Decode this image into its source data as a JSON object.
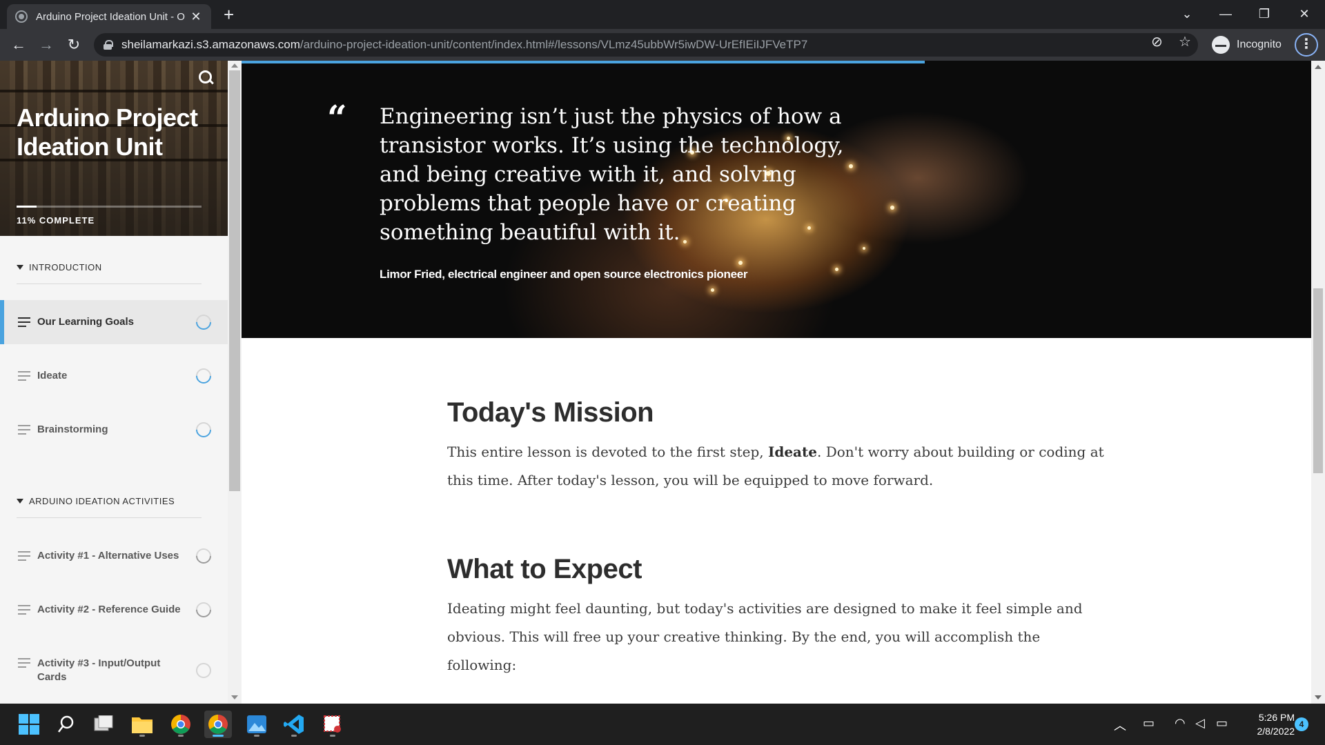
{
  "browser": {
    "tab_title": "Arduino Project Ideation Unit - O",
    "url_host": "sheilamarkazi.s3.amazonaws.com",
    "url_path": "/arduino-project-ideation-unit/content/index.html#/lessons/VLmz45ubbWr5iwDW-UrEfIEiIJFVeTP7",
    "profile_label": "Incognito"
  },
  "sidebar": {
    "course_title": "Arduino Project Ideation Unit",
    "progress_percent": 11,
    "progress_label": "11% COMPLETE",
    "sections": [
      {
        "title": "INTRODUCTION",
        "lessons": [
          {
            "label": "Our Learning Goals",
            "active": true,
            "status_icon": "progress-ring-blue"
          },
          {
            "label": "Ideate",
            "active": false,
            "status_icon": "progress-ring-blue"
          },
          {
            "label": "Brainstorming",
            "active": false,
            "status_icon": "progress-ring-blue"
          }
        ]
      },
      {
        "title": "ARDUINO IDEATION ACTIVITIES",
        "lessons": [
          {
            "label": "Activity #1 - Alternative Uses",
            "active": false,
            "status_icon": "progress-ring-gray"
          },
          {
            "label": "Activity #2 - Reference Guide",
            "active": false,
            "status_icon": "progress-ring-gray"
          },
          {
            "label": "Activity #3 - Input/Output Cards",
            "active": false,
            "status_icon": "empty-ring"
          }
        ]
      }
    ]
  },
  "content": {
    "quote_mark": "“",
    "quote_text": "Engineering isn’t just the physics of how a transistor works. It’s using the technology, and being creative with it, and solving problems that people have or creating something beautiful with it.",
    "quote_citation": "Limor Fried, electrical engineer and open source electronics pioneer",
    "mission_heading": "Today's Mission",
    "mission_text_before": "This entire lesson is devoted to the first step, ",
    "mission_text_bold": "Ideate",
    "mission_text_after": ". Don't worry about building or coding at this time. After today's lesson, you will be equipped to move forward.",
    "expect_heading": "What to Expect",
    "expect_text": "Ideating might feel daunting, but today's activities are designed to make it feel simple and obvious. This will free up your creative thinking. By the end, you will accomplish the following:"
  },
  "taskbar": {
    "time": "5:26 PM",
    "date": "2/8/2022",
    "notification_count": "4",
    "apps": [
      "start-icon",
      "search-icon",
      "task-view-icon",
      "file-explorer-icon",
      "chrome-icon",
      "chrome-incognito-icon",
      "photos-icon",
      "vscode-icon",
      "snipping-tool-icon"
    ]
  },
  "colors": {
    "accent": "#4aa3df",
    "active_lesson_bg": "#e8e8e8",
    "heading": "#2d2d2d"
  }
}
